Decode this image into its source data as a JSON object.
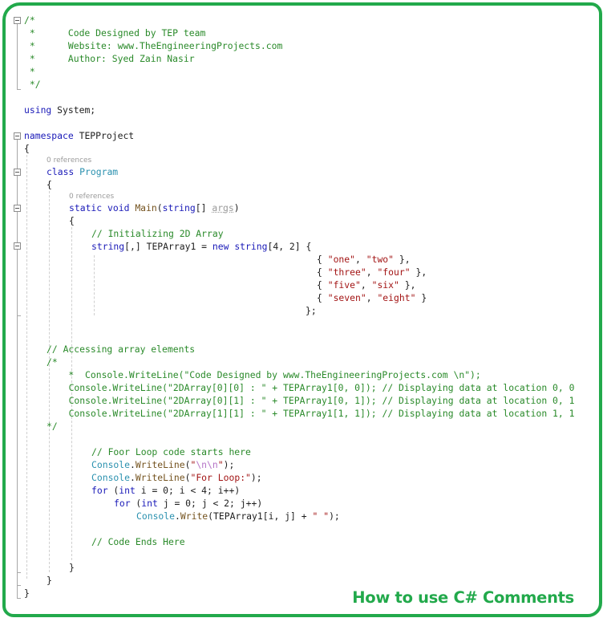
{
  "colors": {
    "frame": "#22a94b",
    "comment": "#2a8a2a",
    "keyword": "#1a1ab8",
    "type": "#2b91af",
    "string": "#a31515",
    "escape": "#b574c7",
    "codelens": "#9a9a9a"
  },
  "header_comment": {
    "open": "/*",
    "line1": " *      Code Designed by TEP team",
    "line2": " *      Website: www.TheEngineeringProjects.com",
    "line3": " *      Author: Syed Zain Nasir",
    "line4": " *",
    "close": " */"
  },
  "using": {
    "keyword": "using",
    "rest": " System;"
  },
  "namespace": {
    "keyword": "namespace",
    "name": " TEPProject"
  },
  "braces": {
    "open": "{",
    "close": "}",
    "close_semicolon": "};"
  },
  "codelens": {
    "class_refs": "0 references",
    "main_refs": "0 references"
  },
  "class_decl": {
    "keyword": "class",
    "name": "Program"
  },
  "main_decl": {
    "static": "static",
    "void": "void",
    "name": "Main",
    "open": "(",
    "string": "string",
    "array": "[] ",
    "param": "args",
    "close": ")"
  },
  "init_comment": "// Initializing 2D Array",
  "array_decl": {
    "string": "string",
    "dims": "[,] TEPArray1 = ",
    "new": "new",
    "space": " ",
    "string2": "string",
    "size": "[4, 2] {"
  },
  "array_rows": [
    {
      "open": "{ ",
      "a": "\"one\"",
      "sep": ", ",
      "b": "\"two\"",
      "close": " },"
    },
    {
      "open": "{ ",
      "a": "\"three\"",
      "sep": ", ",
      "b": "\"four\"",
      "close": " },"
    },
    {
      "open": "{ ",
      "a": "\"five\"",
      "sep": ", ",
      "b": "\"six\"",
      "close": " },"
    },
    {
      "open": "{ ",
      "a": "\"seven\"",
      "sep": ", ",
      "b": "\"eight\"",
      "close": " }"
    }
  ],
  "access_comment": "// Accessing array elements",
  "block_comment": {
    "open": "/*",
    "line1": "    *  Console.WriteLine(\"Code Designed by www.TheEngineeringProjects.com \\n\");",
    "line2": "   Console.WriteLine(\"2DArray[0][0] : \" + TEPArray1[0, 0]); // Displaying data at location 0, 0",
    "line3": "   Console.WriteLine(\"2DArray[0][1] : \" + TEPArray1[0, 1]); // Displaying data at location 0, 1",
    "line4": "   Console.WriteLine(\"2DArray[1][1] : \" + TEPArray1[1, 1]); // Displaying data at location 1, 1",
    "close": "*/"
  },
  "loop_comment": "// Foor Loop code starts here",
  "writeline1": {
    "cls": "Console",
    "dot": ".",
    "method": "WriteLine",
    "open": "(",
    "q1": "\"",
    "esc": "\\n\\n",
    "q2": "\"",
    "close": ");"
  },
  "writeline2": {
    "cls": "Console",
    "dot": ".",
    "method": "WriteLine",
    "open": "(",
    "str": "\"For Loop:\"",
    "close": ");"
  },
  "for_outer": {
    "for": "for",
    "open": " (",
    "int": "int",
    "rest": " i = 0; i < 4; i++)"
  },
  "for_inner": {
    "for": "for",
    "open": " (",
    "int": "int",
    "rest": " j = 0; j < 2; j++)"
  },
  "write_call": {
    "cls": "Console",
    "dot": ".",
    "method": "Write",
    "mid": "(TEPArray1[i, j] + ",
    "str": "\" \"",
    "close": ");"
  },
  "end_comment": "// Code Ends Here",
  "caption": "How to use C# Comments"
}
